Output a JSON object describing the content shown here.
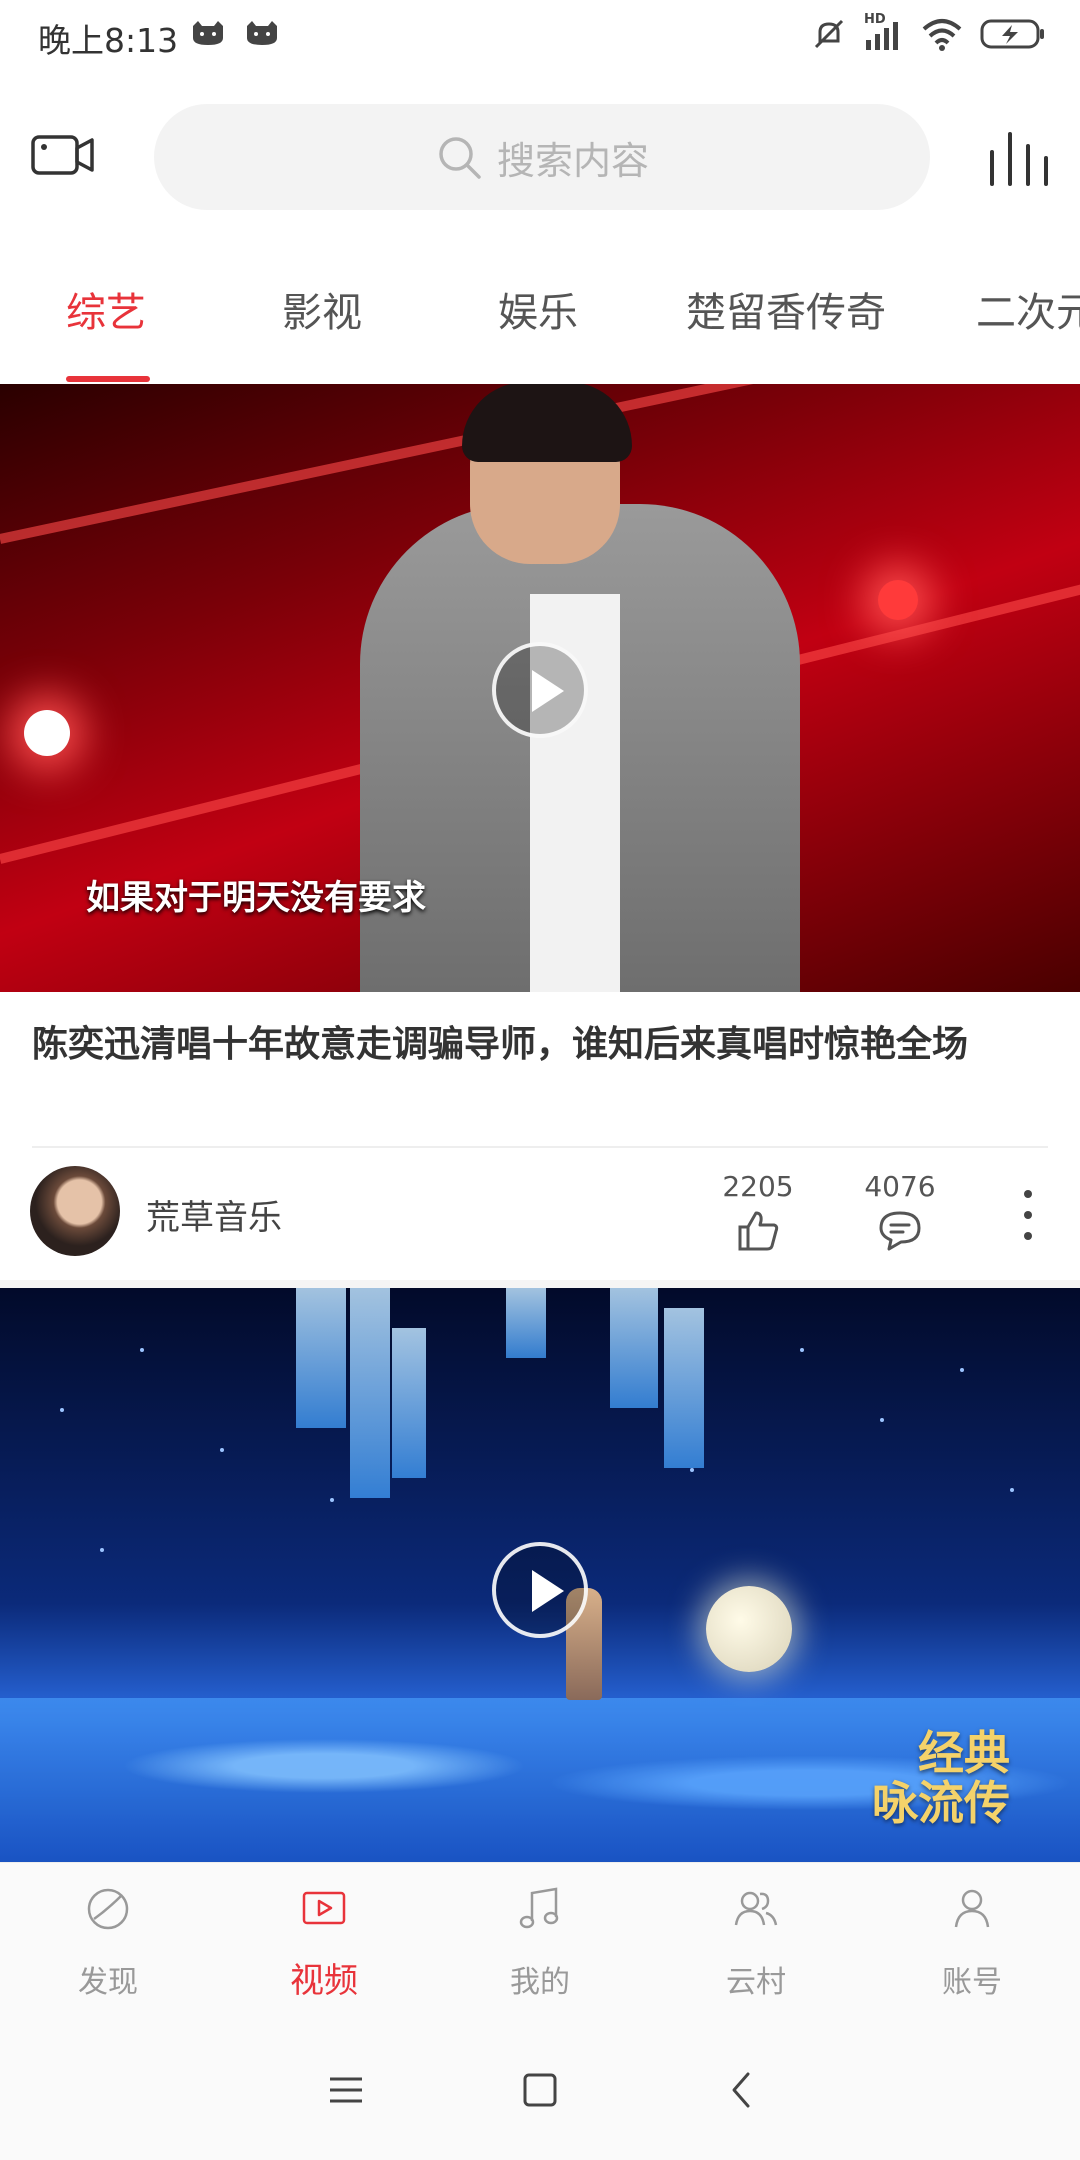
{
  "status_bar": {
    "time": "晚上8:13",
    "network_label": "HD"
  },
  "header": {
    "search_placeholder": "搜索内容"
  },
  "tabs": [
    {
      "label": "综艺",
      "active": true
    },
    {
      "label": "影视",
      "active": false
    },
    {
      "label": "娱乐",
      "active": false
    },
    {
      "label": "楚留香传奇",
      "active": false
    },
    {
      "label": "二次元",
      "active": false
    }
  ],
  "feed": [
    {
      "subtitle": "如果对于明天没有要求",
      "title": "陈奕迅清唱十年故意走调骗导师，谁知后来真唱时惊艳全场",
      "channel": "荒草音乐",
      "likes": "2205",
      "comments": "4076"
    },
    {
      "overlay_text_line1": "经典",
      "overlay_text_line2": "咏流传"
    }
  ],
  "bottom_nav": [
    {
      "label": "发现",
      "icon": "compass-icon",
      "active": false
    },
    {
      "label": "视频",
      "icon": "video-icon",
      "active": true
    },
    {
      "label": "我的",
      "icon": "music-note-icon",
      "active": false
    },
    {
      "label": "云村",
      "icon": "users-icon",
      "active": false
    },
    {
      "label": "账号",
      "icon": "user-icon",
      "active": false
    }
  ],
  "colors": {
    "accent": "#e8333a",
    "inactive": "#999999",
    "search_bg": "#f3f3f3"
  }
}
